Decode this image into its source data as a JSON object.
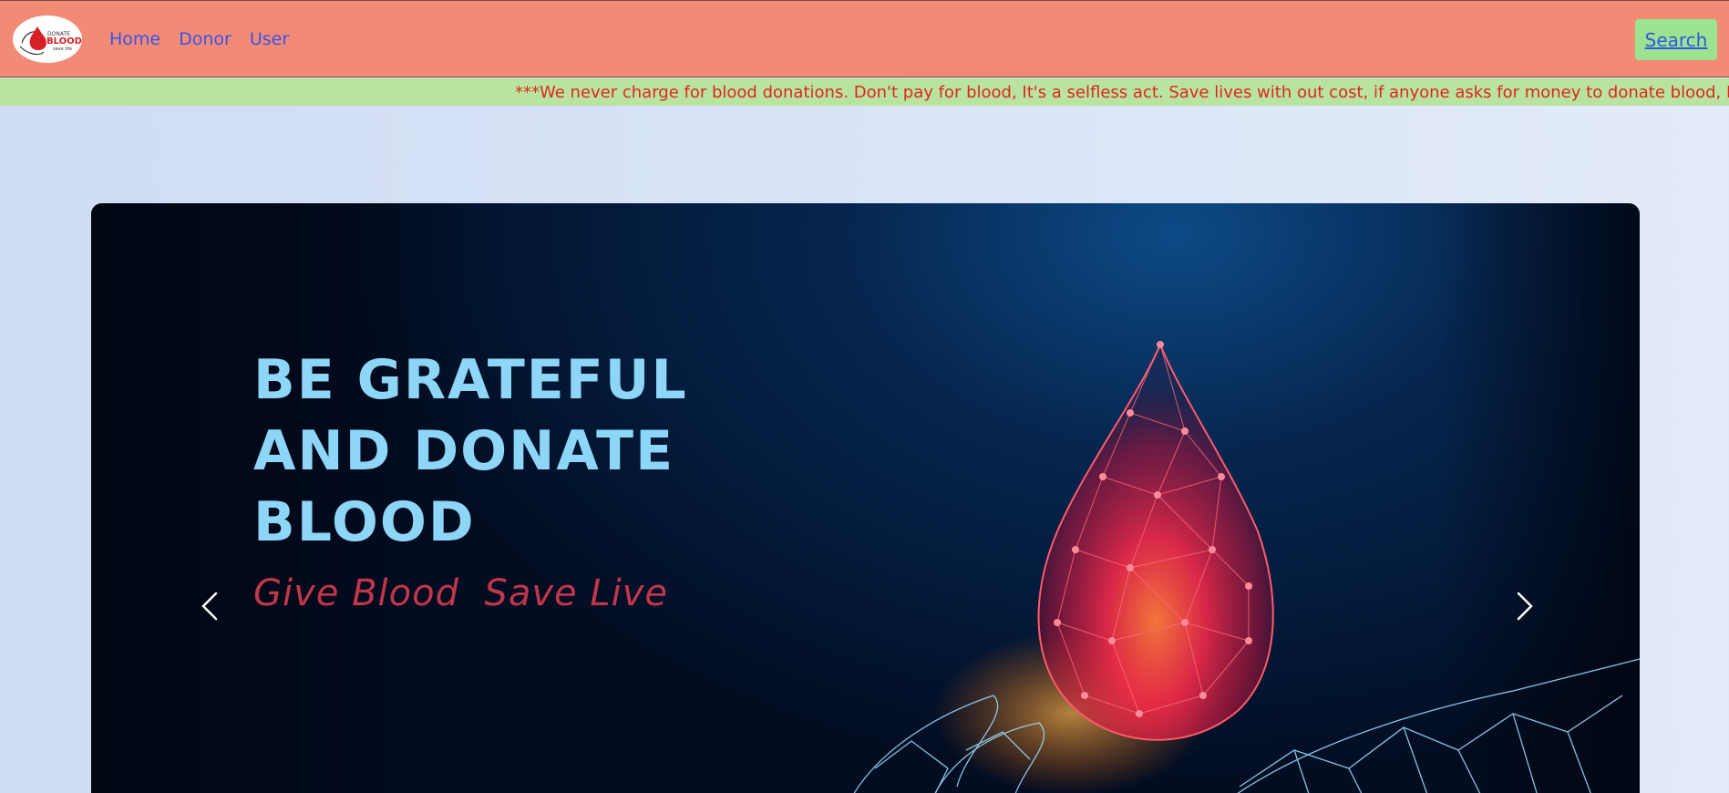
{
  "header": {
    "logo_icon": "blood-drop-logo",
    "nav": [
      {
        "label": "Home"
      },
      {
        "label": "Donor"
      },
      {
        "label": "User"
      }
    ],
    "search_label": "Search"
  },
  "notice": {
    "text": "***We never charge for blood donations. Don't pay for blood, It's a selfless act. Save lives with out cost, if anyone asks for money to donate blood, Pleas"
  },
  "carousel": {
    "headline_lines": [
      "BE GRATEFUL",
      "AND DONATE",
      "BLOOD"
    ],
    "tagline": "Give Blood  Save Live",
    "prev_icon": "chevron-left-icon",
    "next_icon": "chevron-right-icon"
  },
  "colors": {
    "navbar": "#f28b76",
    "nav_link": "#3b52e8",
    "search_button": "#9be38f",
    "notice_bar": "#b8e49f",
    "notice_text": "#e0261f",
    "headline": "#8dd6f7",
    "tagline": "#c0364a"
  }
}
